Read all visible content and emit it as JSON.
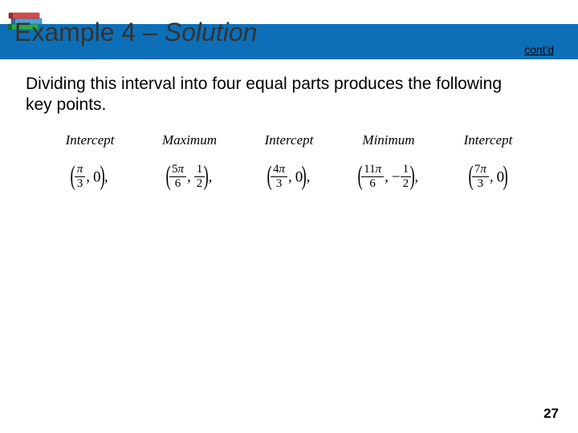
{
  "header": {
    "title_prefix": "Example 4 – ",
    "title_italic": "Solution",
    "contd": "cont'd"
  },
  "body": {
    "text": "Dividing this interval into four equal parts produces the following key points."
  },
  "points": [
    {
      "label": "Intercept",
      "num1": "π",
      "den1": "3",
      "second_is_frac": false,
      "val2": "0",
      "neg2": false
    },
    {
      "label": "Maximum",
      "num1": "5π",
      "den1": "6",
      "second_is_frac": true,
      "num2": "1",
      "den2": "2",
      "neg2": false
    },
    {
      "label": "Intercept",
      "num1": "4π",
      "den1": "3",
      "second_is_frac": false,
      "val2": "0",
      "neg2": false
    },
    {
      "label": "Minimum",
      "num1": "11π",
      "den1": "6",
      "second_is_frac": true,
      "num2": "1",
      "den2": "2",
      "neg2": true
    },
    {
      "label": "Intercept",
      "num1": "7π",
      "den1": "3",
      "second_is_frac": false,
      "val2": "0",
      "neg2": false
    }
  ],
  "page_number": "27"
}
